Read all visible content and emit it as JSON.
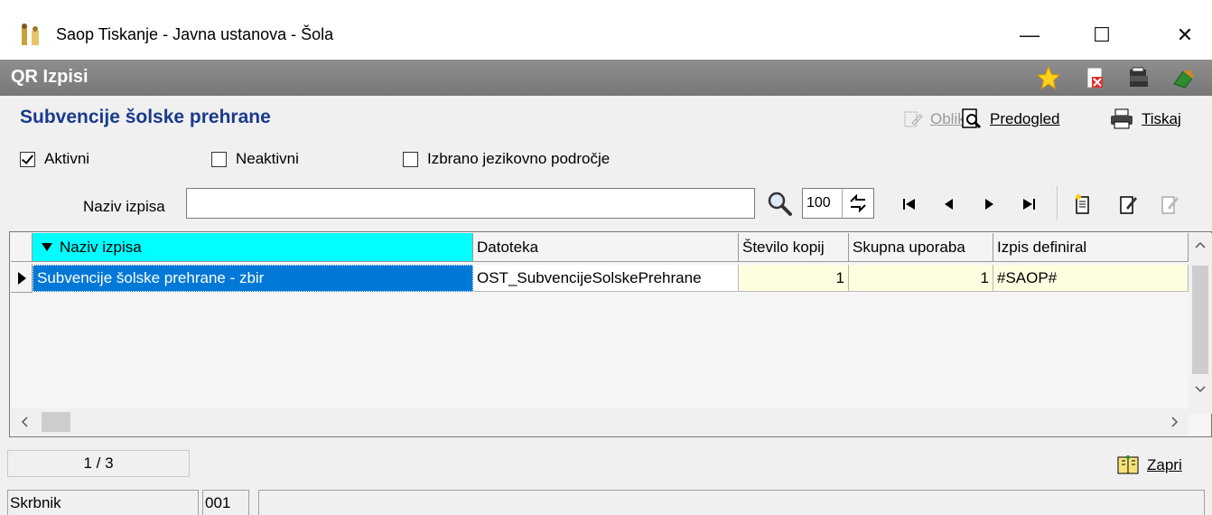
{
  "window": {
    "title": "Saop Tiskanje - Javna ustanova - Šola",
    "minimize_glyph": "—",
    "maximize_glyph": "☐",
    "close_glyph": "✕"
  },
  "header_bar": {
    "title": "QR Izpisi",
    "icons": [
      "star-icon",
      "close-document-icon",
      "printers-icon",
      "exit-icon"
    ]
  },
  "report": {
    "title": "Subvencije šolske prehrane"
  },
  "toolbar": {
    "oblikuj_label": "Oblikuj",
    "predogled_label": "Predogled",
    "tiskaj_label": "Tiskaj"
  },
  "filters": [
    {
      "label": "Aktivni",
      "checked": true
    },
    {
      "label": "Neaktivni",
      "checked": false
    },
    {
      "label": "Izbrano jezikovno področje",
      "checked": false
    }
  ],
  "search": {
    "label": "Naziv izpisa",
    "value": "",
    "zoom": "100"
  },
  "grid": {
    "columns": [
      "Naziv izpisa",
      "Datoteka",
      "Število kopij",
      "Skupna uporaba",
      "Izpis definiral"
    ],
    "rows": [
      {
        "naziv": "Subvencije šolske prehrane - zbir",
        "datoteka": "OST_SubvencijeSolskePrehrane",
        "stevilo_kopij": "1",
        "skupna_uporaba": "1",
        "izpis_definiral": "#SAOP#"
      }
    ]
  },
  "pager": {
    "text": "1 / 3"
  },
  "close_button": {
    "label": "Zapri"
  },
  "status_bar": {
    "user": "Skrbnik",
    "code": "001"
  },
  "colors": {
    "selected_row": "#0078d7",
    "sort_header": "#00ffff",
    "row_background": "#fffde0",
    "report_title": "#1a3a8c"
  }
}
